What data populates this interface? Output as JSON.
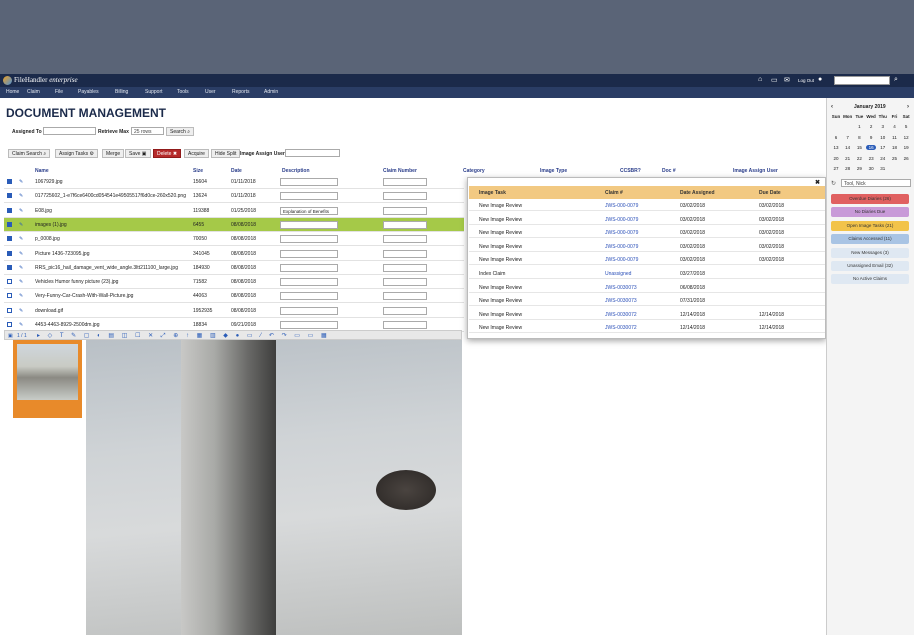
{
  "app": {
    "brand_prefix": "FileHandler",
    "brand_suffix": "enterprise",
    "logout": "Log Out"
  },
  "nav": [
    "Home",
    "Claim",
    "File",
    "Payables",
    "Billing",
    "Support",
    "Tools",
    "User",
    "Reports",
    "Admin"
  ],
  "page": {
    "title": "DOCUMENT MANAGEMENT"
  },
  "filters": {
    "assigned_to_label": "Assigned To",
    "retrieve_max_label": "Retrieve Max",
    "retrieve_max_value": "25 rows",
    "search": "Search"
  },
  "toolbar": {
    "claim_search": "Claim Search",
    "assign_tasks": "Assign Tasks",
    "merge": "Merge",
    "save": "Save",
    "delete": "Delete",
    "acquire": "Acquire",
    "hide_split": "Hide Split",
    "image_assign_user_label": "Image Assign User"
  },
  "columns": [
    "Name",
    "Size",
    "Date",
    "Description",
    "Claim Number",
    "Category",
    "Image Type",
    "CCSBR?",
    "Doc #",
    "Image Assign User"
  ],
  "rows": [
    {
      "name": "1067929.jpg",
      "size": "15604",
      "date": "01/11/2018",
      "desc": "",
      "checked": true
    },
    {
      "name": "017725602_1-e7f6ce6400cd054541e49505517f6d0ce-260x520.png",
      "size": "13624",
      "date": "01/11/2018",
      "desc": "",
      "checked": true
    },
    {
      "name": "E08.jpg",
      "size": "119388",
      "date": "01/25/2018",
      "desc": "Explanation of Benefits",
      "checked": true
    },
    {
      "name": "images (1).jpg",
      "size": "6455",
      "date": "08/08/2018",
      "desc": "",
      "checked": true
    },
    {
      "name": "p_0008.jpg",
      "size": "70050",
      "date": "08/08/2018",
      "desc": "",
      "checked": true
    },
    {
      "name": "Picture 1436-723095.jpg",
      "size": "341045",
      "date": "08/08/2018",
      "desc": "",
      "checked": true
    },
    {
      "name": "RRS_pic16_hail_damage_vent_wide_angle.3ltt211100_large.jpg",
      "size": "184930",
      "date": "08/08/2018",
      "desc": "",
      "checked": true
    },
    {
      "name": "Vehicles Humor funny picture (23).jpg",
      "size": "71582",
      "date": "08/08/2018",
      "desc": "",
      "checked": false
    },
    {
      "name": "Very-Funny-Car-Crash-With-Wall-Picture.jpg",
      "size": "44063",
      "date": "08/08/2018",
      "desc": "",
      "checked": false
    },
    {
      "name": "download.gif",
      "size": "1952935",
      "date": "08/08/2018",
      "desc": "",
      "checked": false
    },
    {
      "name": "4453-4463-8929-2500dm.jpg",
      "size": "18834",
      "date": "09/21/2018",
      "desc": "",
      "checked": false
    }
  ],
  "viewer": {
    "page_indicator": "1 / 1"
  },
  "popup": {
    "columns": [
      "Image Task",
      "Claim #",
      "Date Assigned",
      "Due Date"
    ],
    "rows": [
      {
        "task": "New Image Review",
        "claim": "JWS-000-0079",
        "assigned": "03/02/2018",
        "due": "03/02/2018"
      },
      {
        "task": "New Image Review",
        "claim": "JWS-000-0079",
        "assigned": "03/02/2018",
        "due": "03/02/2018"
      },
      {
        "task": "New Image Review",
        "claim": "JWS-000-0079",
        "assigned": "03/02/2018",
        "due": "03/02/2018"
      },
      {
        "task": "New Image Review",
        "claim": "JWS-000-0079",
        "assigned": "03/02/2018",
        "due": "03/02/2018"
      },
      {
        "task": "New Image Review",
        "claim": "JWS-000-0079",
        "assigned": "03/02/2018",
        "due": "03/02/2018"
      },
      {
        "task": "Index Claim",
        "claim": "Unassigned",
        "assigned": "03/27/2018",
        "due": ""
      },
      {
        "task": "New Image Review",
        "claim": "JWS-0030073",
        "assigned": "06/08/2018",
        "due": ""
      },
      {
        "task": "New Image Review",
        "claim": "JWS-0030073",
        "assigned": "07/31/2018",
        "due": ""
      },
      {
        "task": "New Image Review",
        "claim": "JWS-0030072",
        "assigned": "12/14/2018",
        "due": "12/14/2018"
      },
      {
        "task": "New Image Review",
        "claim": "JWS-0030072",
        "assigned": "12/14/2018",
        "due": "12/14/2018"
      }
    ]
  },
  "calendar": {
    "title": "January 2019",
    "weekdays": [
      "Sun",
      "Mon",
      "Tue",
      "Wed",
      "Thu",
      "Fri",
      "Sat"
    ],
    "weeks": [
      [
        "",
        "",
        "1",
        "2",
        "3",
        "4",
        "5"
      ],
      [
        "6",
        "7",
        "8",
        "9",
        "10",
        "11",
        "12"
      ],
      [
        "13",
        "14",
        "15",
        "16",
        "17",
        "18",
        "19"
      ],
      [
        "20",
        "21",
        "22",
        "23",
        "24",
        "25",
        "26"
      ],
      [
        "27",
        "28",
        "29",
        "30",
        "31",
        "",
        ""
      ]
    ],
    "today": "16"
  },
  "user": {
    "selected": "Tool, Nick"
  },
  "side_buttons": [
    {
      "label": "Overdue Diaries (26)",
      "color": "#e06060"
    },
    {
      "label": "No Diaries Due",
      "color": "#c89ad8"
    },
    {
      "label": "Open Image Tasks (21)",
      "color": "#f2c34a"
    },
    {
      "label": "Claims Accessed (11)",
      "color": "#a9c4e4"
    },
    {
      "label": "New Messages (3)",
      "color": "#dfe8f2"
    },
    {
      "label": "Unassigned Email (32)",
      "color": "#dfe8f2"
    },
    {
      "label": "No Active Claims",
      "color": "#dfe8f2"
    }
  ]
}
